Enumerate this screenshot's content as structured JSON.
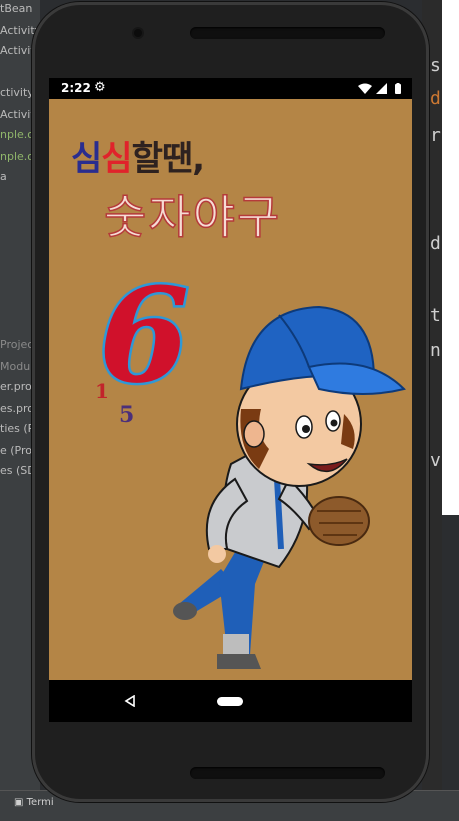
{
  "ide": {
    "project_tree": [
      {
        "label": "tBean",
        "style": ""
      },
      {
        "label": "Activity",
        "style": ""
      },
      {
        "label": "Activity",
        "style": ""
      },
      {
        "label": "ctivity",
        "style": ""
      },
      {
        "label": "Activit",
        "style": ""
      },
      {
        "label": "nple.or",
        "style": "green"
      },
      {
        "label": "nple.or",
        "style": "green"
      },
      {
        "label": "a",
        "style": ""
      },
      {
        "label": "Projec",
        "style": "dim"
      },
      {
        "label": "Modu",
        "style": "dim"
      },
      {
        "label": "er.prop",
        "style": ""
      },
      {
        "label": "es.pro",
        "style": ""
      },
      {
        "label": "ties (Pr",
        "style": ""
      },
      {
        "label": "e (Proj",
        "style": ""
      },
      {
        "label": "es (SD",
        "style": ""
      }
    ],
    "code_chars": [
      "s",
      "d",
      "r",
      "d",
      "t",
      "n",
      "v"
    ],
    "terminal_label": "Termi"
  },
  "status_bar": {
    "time": "2:22"
  },
  "app": {
    "title_line1": {
      "a": "심",
      "b": "심",
      "c": "할땐,"
    },
    "title_line2": "숫자야구",
    "digits": {
      "big": "6",
      "small1": "1",
      "small2": "5"
    }
  },
  "colors": {
    "app_background": "#b48546",
    "title_blue": "#2a2d8f",
    "title_red": "#e0232b",
    "title_dark": "#2e2220",
    "digit_red": "#d0112b",
    "digit_blue": "#2f98d6"
  },
  "icons": {
    "settings": "gear-icon",
    "wifi": "wifi-icon",
    "signal": "signal-icon",
    "battery": "battery-icon",
    "back": "back-triangle-icon",
    "home": "home-pill-icon"
  }
}
